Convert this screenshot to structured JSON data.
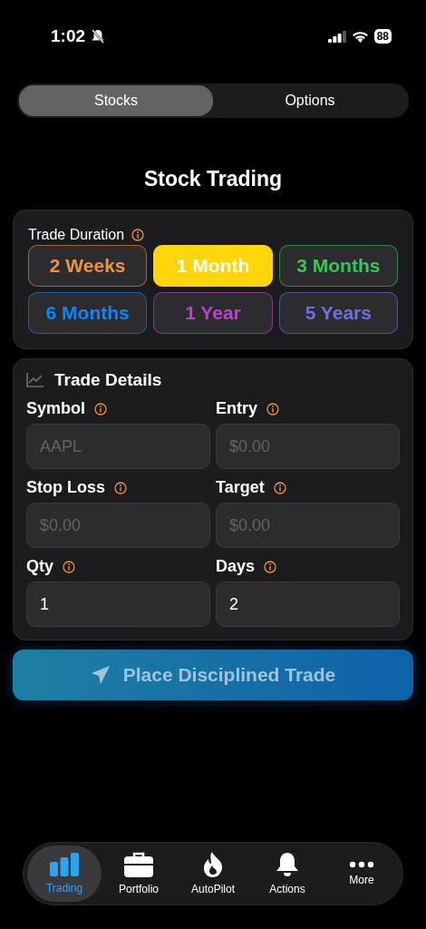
{
  "status_bar": {
    "time": "1:02",
    "battery": "88"
  },
  "segments": [
    {
      "label": "Stocks",
      "selected": true
    },
    {
      "label": "Options",
      "selected": false
    }
  ],
  "title": "Stock Trading",
  "duration": {
    "label": "Trade Duration",
    "options": [
      {
        "label": "2 Weeks",
        "color": "#f0923a",
        "selected": false
      },
      {
        "label": "1 Month",
        "color": "#ffd60a",
        "selected": true
      },
      {
        "label": "3 Months",
        "color": "#34c759",
        "selected": false
      },
      {
        "label": "6 Months",
        "color": "#0a84ff",
        "selected": false
      },
      {
        "label": "1 Year",
        "color": "#bf40d0",
        "selected": false
      },
      {
        "label": "5 Years",
        "color": "#6e6ee6",
        "selected": false
      }
    ]
  },
  "details": {
    "title": "Trade Details",
    "fields": [
      {
        "label": "Symbol",
        "placeholder": "AAPL"
      },
      {
        "label": "Entry",
        "placeholder": "$0.00"
      },
      {
        "label": "Stop Loss",
        "placeholder": "$0.00"
      },
      {
        "label": "Target",
        "placeholder": "$0.00"
      },
      {
        "label": "Qty",
        "value": "1"
      },
      {
        "label": "Days",
        "value": "2"
      }
    ]
  },
  "submit": {
    "label": "Place Disciplined Trade",
    "disabled": true
  },
  "tab_bar": [
    {
      "label": "Trading",
      "kind": "bars",
      "selected": true
    },
    {
      "label": "Portfolio",
      "kind": "briefcase",
      "selected": false
    },
    {
      "label": "AutoPilot",
      "kind": "flame",
      "selected": false
    },
    {
      "label": "Actions",
      "kind": "bell",
      "selected": false
    },
    {
      "label": "More",
      "kind": "dots",
      "selected": false
    }
  ]
}
